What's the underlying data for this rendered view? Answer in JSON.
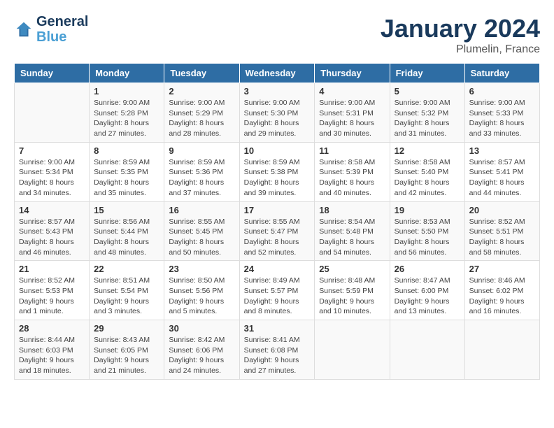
{
  "header": {
    "logo_line1": "General",
    "logo_line2": "Blue",
    "month": "January 2024",
    "location": "Plumelin, France"
  },
  "columns": [
    "Sunday",
    "Monday",
    "Tuesday",
    "Wednesday",
    "Thursday",
    "Friday",
    "Saturday"
  ],
  "weeks": [
    [
      {
        "day": "",
        "info": ""
      },
      {
        "day": "1",
        "info": "Sunrise: 9:00 AM\nSunset: 5:28 PM\nDaylight: 8 hours\nand 27 minutes."
      },
      {
        "day": "2",
        "info": "Sunrise: 9:00 AM\nSunset: 5:29 PM\nDaylight: 8 hours\nand 28 minutes."
      },
      {
        "day": "3",
        "info": "Sunrise: 9:00 AM\nSunset: 5:30 PM\nDaylight: 8 hours\nand 29 minutes."
      },
      {
        "day": "4",
        "info": "Sunrise: 9:00 AM\nSunset: 5:31 PM\nDaylight: 8 hours\nand 30 minutes."
      },
      {
        "day": "5",
        "info": "Sunrise: 9:00 AM\nSunset: 5:32 PM\nDaylight: 8 hours\nand 31 minutes."
      },
      {
        "day": "6",
        "info": "Sunrise: 9:00 AM\nSunset: 5:33 PM\nDaylight: 8 hours\nand 33 minutes."
      }
    ],
    [
      {
        "day": "7",
        "info": "Sunrise: 9:00 AM\nSunset: 5:34 PM\nDaylight: 8 hours\nand 34 minutes."
      },
      {
        "day": "8",
        "info": "Sunrise: 8:59 AM\nSunset: 5:35 PM\nDaylight: 8 hours\nand 35 minutes."
      },
      {
        "day": "9",
        "info": "Sunrise: 8:59 AM\nSunset: 5:36 PM\nDaylight: 8 hours\nand 37 minutes."
      },
      {
        "day": "10",
        "info": "Sunrise: 8:59 AM\nSunset: 5:38 PM\nDaylight: 8 hours\nand 39 minutes."
      },
      {
        "day": "11",
        "info": "Sunrise: 8:58 AM\nSunset: 5:39 PM\nDaylight: 8 hours\nand 40 minutes."
      },
      {
        "day": "12",
        "info": "Sunrise: 8:58 AM\nSunset: 5:40 PM\nDaylight: 8 hours\nand 42 minutes."
      },
      {
        "day": "13",
        "info": "Sunrise: 8:57 AM\nSunset: 5:41 PM\nDaylight: 8 hours\nand 44 minutes."
      }
    ],
    [
      {
        "day": "14",
        "info": "Sunrise: 8:57 AM\nSunset: 5:43 PM\nDaylight: 8 hours\nand 46 minutes."
      },
      {
        "day": "15",
        "info": "Sunrise: 8:56 AM\nSunset: 5:44 PM\nDaylight: 8 hours\nand 48 minutes."
      },
      {
        "day": "16",
        "info": "Sunrise: 8:55 AM\nSunset: 5:45 PM\nDaylight: 8 hours\nand 50 minutes."
      },
      {
        "day": "17",
        "info": "Sunrise: 8:55 AM\nSunset: 5:47 PM\nDaylight: 8 hours\nand 52 minutes."
      },
      {
        "day": "18",
        "info": "Sunrise: 8:54 AM\nSunset: 5:48 PM\nDaylight: 8 hours\nand 54 minutes."
      },
      {
        "day": "19",
        "info": "Sunrise: 8:53 AM\nSunset: 5:50 PM\nDaylight: 8 hours\nand 56 minutes."
      },
      {
        "day": "20",
        "info": "Sunrise: 8:52 AM\nSunset: 5:51 PM\nDaylight: 8 hours\nand 58 minutes."
      }
    ],
    [
      {
        "day": "21",
        "info": "Sunrise: 8:52 AM\nSunset: 5:53 PM\nDaylight: 9 hours\nand 1 minute."
      },
      {
        "day": "22",
        "info": "Sunrise: 8:51 AM\nSunset: 5:54 PM\nDaylight: 9 hours\nand 3 minutes."
      },
      {
        "day": "23",
        "info": "Sunrise: 8:50 AM\nSunset: 5:56 PM\nDaylight: 9 hours\nand 5 minutes."
      },
      {
        "day": "24",
        "info": "Sunrise: 8:49 AM\nSunset: 5:57 PM\nDaylight: 9 hours\nand 8 minutes."
      },
      {
        "day": "25",
        "info": "Sunrise: 8:48 AM\nSunset: 5:59 PM\nDaylight: 9 hours\nand 10 minutes."
      },
      {
        "day": "26",
        "info": "Sunrise: 8:47 AM\nSunset: 6:00 PM\nDaylight: 9 hours\nand 13 minutes."
      },
      {
        "day": "27",
        "info": "Sunrise: 8:46 AM\nSunset: 6:02 PM\nDaylight: 9 hours\nand 16 minutes."
      }
    ],
    [
      {
        "day": "28",
        "info": "Sunrise: 8:44 AM\nSunset: 6:03 PM\nDaylight: 9 hours\nand 18 minutes."
      },
      {
        "day": "29",
        "info": "Sunrise: 8:43 AM\nSunset: 6:05 PM\nDaylight: 9 hours\nand 21 minutes."
      },
      {
        "day": "30",
        "info": "Sunrise: 8:42 AM\nSunset: 6:06 PM\nDaylight: 9 hours\nand 24 minutes."
      },
      {
        "day": "31",
        "info": "Sunrise: 8:41 AM\nSunset: 6:08 PM\nDaylight: 9 hours\nand 27 minutes."
      },
      {
        "day": "",
        "info": ""
      },
      {
        "day": "",
        "info": ""
      },
      {
        "day": "",
        "info": ""
      }
    ]
  ]
}
